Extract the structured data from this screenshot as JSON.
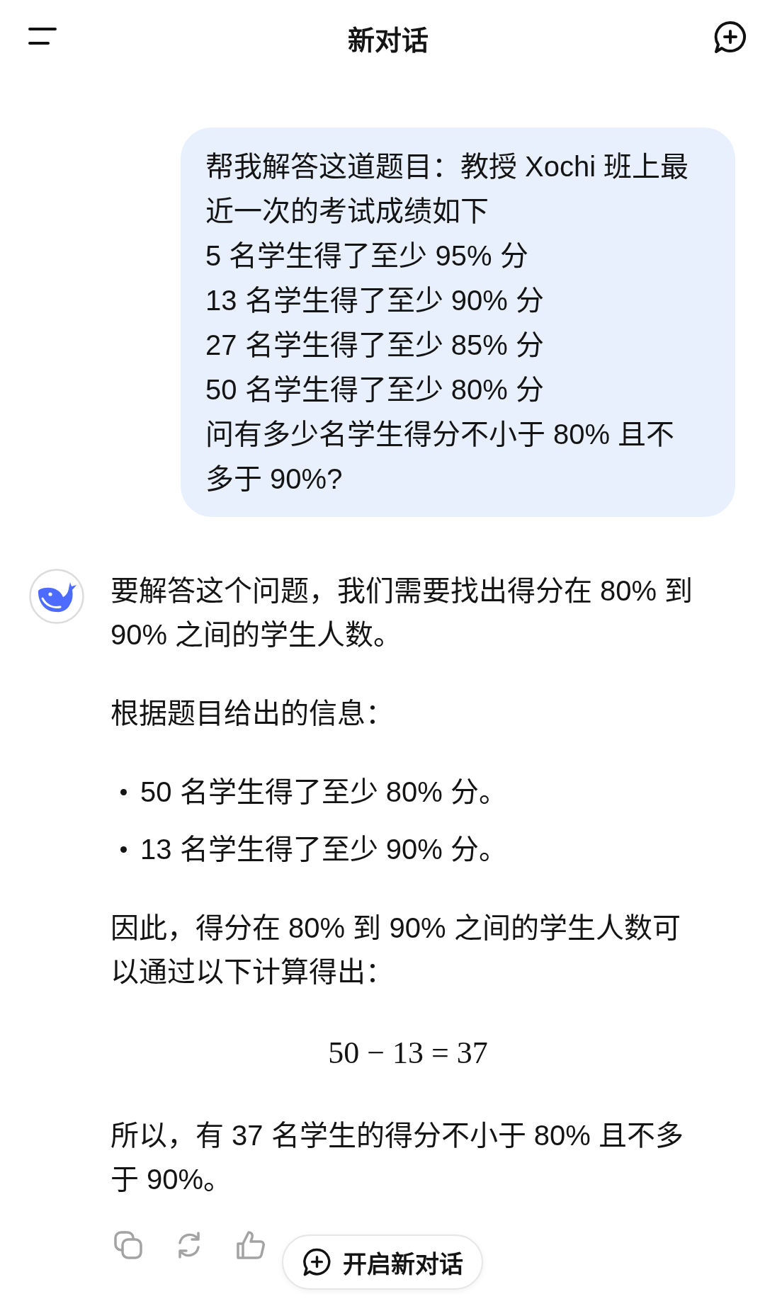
{
  "header": {
    "title": "新对话"
  },
  "messages": [
    {
      "kind": "user",
      "lines": [
        "帮我解答这道题目：教授 Xochi 班上最近一次的考试成绩如下",
        "5 名学生得了至少 95% 分",
        "13 名学生得了至少 90% 分",
        "27 名学生得了至少 85% 分",
        "50 名学生得了至少 80% 分",
        "问有多少名学生得分不小于 80% 且不多于 90%?"
      ]
    },
    {
      "kind": "assistant",
      "blocks": [
        {
          "kind": "paragraph",
          "text": "要解答这个问题，我们需要找出得分在 80% 到 90% 之间的学生人数。"
        },
        {
          "kind": "paragraph",
          "text": "根据题目给出的信息："
        },
        {
          "kind": "list",
          "items": [
            "50 名学生得了至少 80% 分。",
            "13 名学生得了至少 90% 分。"
          ]
        },
        {
          "kind": "paragraph",
          "text": "因此，得分在 80% 到 90% 之间的学生人数可以通过以下计算得出："
        },
        {
          "kind": "math",
          "text": "50 − 13 = 37"
        },
        {
          "kind": "paragraph",
          "text": "所以，有 37 名学生的得分不小于 80% 且不多于 90%。"
        }
      ]
    }
  ],
  "floating_button": {
    "label": "开启新对话"
  }
}
